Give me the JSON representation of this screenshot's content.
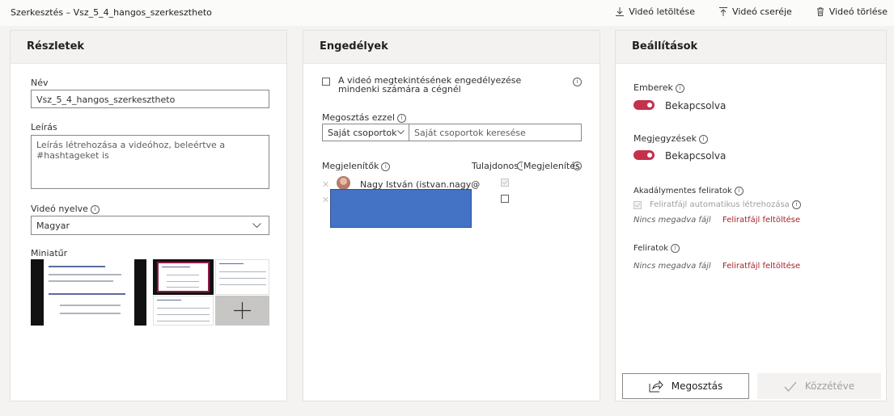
{
  "header": {
    "breadcrumb": "Szerkesztés – Vsz_5_4_hangos_szerkesztheto",
    "download": "Videó letöltése",
    "replace": "Videó cseréje",
    "delete": "Videó törlése"
  },
  "details": {
    "title": "Részletek",
    "name_label": "Név",
    "name_value": "Vsz_5_4_hangos_szerkesztheto",
    "desc_label": "Leírás",
    "desc_placeholder": "Leírás létrehozása a videóhoz, beleértve a #hashtageket is",
    "lang_label": "Videó nyelve",
    "lang_value": "Magyar",
    "thumb_label": "Miniatűr"
  },
  "permissions": {
    "title": "Engedélyek",
    "allow_all_label": "A videó megtekintésének engedélyezése mindenki számára a cégnél",
    "share_with_label": "Megosztás ezzel",
    "group_select": "Saját csoportok",
    "group_search_placeholder": "Saját csoportok keresése",
    "col_viewers": "Megjelenítők",
    "col_owner": "Tulajdonos",
    "col_display": "Megjelenítés",
    "rows": [
      {
        "name": "Nagy István (istvan.nagy@"
      }
    ]
  },
  "settings": {
    "title": "Beállítások",
    "people_label": "Emberek",
    "people_state": "Bekapcsolva",
    "comments_label": "Megjegyzések",
    "comments_state": "Bekapcsolva",
    "a11y_captions_label": "Akadálymentes feliratok",
    "auto_caption_label": "Feliratfájl automatikus létrehozása",
    "no_file_1": "Nincs megadva fájl",
    "upload_1": "Feliratfájl feltöltése",
    "captions_label": "Feliratok",
    "no_file_2": "Nincs megadva fájl",
    "upload_2": "Feliratfájl feltöltése",
    "share_button": "Megosztás",
    "publish_button": "Közzétéve"
  },
  "colors": {
    "accent": "#c4314b",
    "redaction": "#4472c4",
    "link": "#a4262c"
  }
}
